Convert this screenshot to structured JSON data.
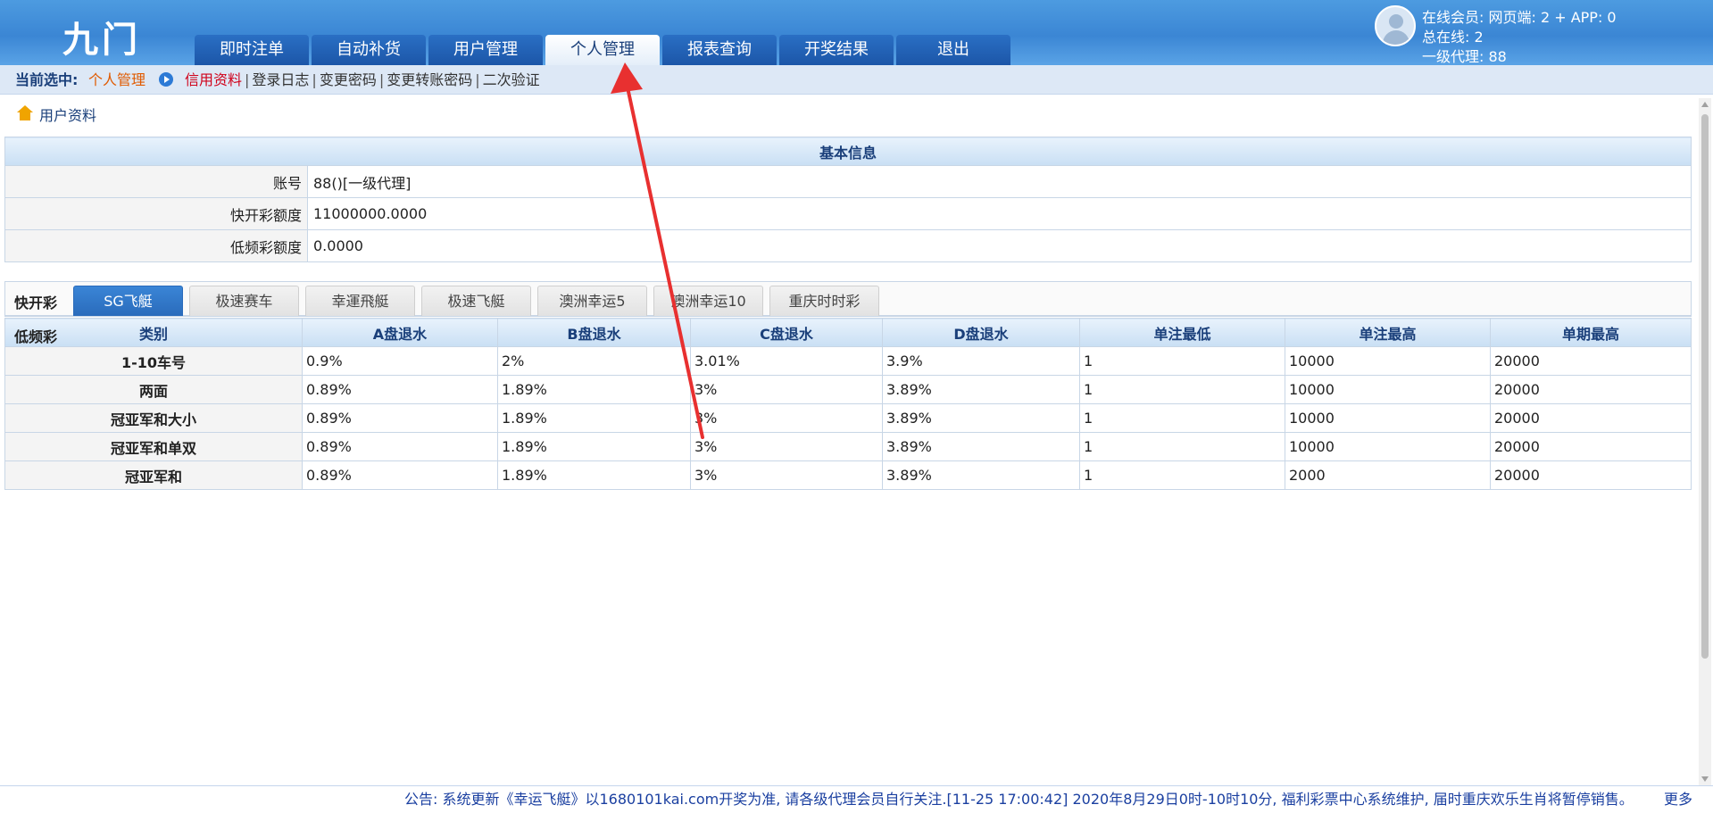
{
  "app": {
    "logo": "九门"
  },
  "nav": [
    "即时注单",
    "自动补货",
    "用户管理",
    "个人管理",
    "报表查询",
    "开奖结果",
    "退出"
  ],
  "nav_active_index": 3,
  "online": {
    "members": "在线会员:  网页端: 2 + APP: 0",
    "total": "总在线: 2",
    "agent": "一级代理: 88"
  },
  "subnav": {
    "label": "当前选中:",
    "current": "个人管理",
    "links": [
      "信用资料",
      "登录日志",
      "变更密码",
      "变更转账密码",
      "二次验证"
    ]
  },
  "breadcrumb": "用户资料",
  "basic_info": {
    "header": "基本信息",
    "rows": [
      {
        "key": "账号",
        "value": "88()[一级代理]"
      },
      {
        "key": "快开彩额度",
        "value": "11000000.0000"
      },
      {
        "key": "低频彩额度",
        "value": "0.0000"
      }
    ]
  },
  "tabs": {
    "label": "快开彩",
    "items": [
      "SG飞艇",
      "极速赛车",
      "幸運飛艇",
      "极速飞艇",
      "澳洲幸运5",
      "澳洲幸运10",
      "重庆时时彩"
    ],
    "active_index": 0
  },
  "rates": {
    "corner_label": "低频彩",
    "headers": [
      "类别",
      "A盘退水",
      "B盘退水",
      "C盘退水",
      "D盘退水",
      "单注最低",
      "单注最高",
      "单期最高"
    ],
    "rows": [
      [
        "1-10车号",
        "0.9%",
        "2%",
        "3.01%",
        "3.9%",
        "1",
        "10000",
        "20000"
      ],
      [
        "两面",
        "0.89%",
        "1.89%",
        "3%",
        "3.89%",
        "1",
        "10000",
        "20000"
      ],
      [
        "冠亚军和大小",
        "0.89%",
        "1.89%",
        "3%",
        "3.89%",
        "1",
        "10000",
        "20000"
      ],
      [
        "冠亚军和单双",
        "0.89%",
        "1.89%",
        "3%",
        "3.89%",
        "1",
        "10000",
        "20000"
      ],
      [
        "冠亚军和",
        "0.89%",
        "1.89%",
        "3%",
        "3.89%",
        "1",
        "2000",
        "20000"
      ]
    ]
  },
  "footer": {
    "notice": "公告: 系统更新《幸运飞艇》以1680101kai.com开奖为准, 请各级代理会员自行关注.[11-25 17:00:42] 2020年8月29日0时-10时10分, 福利彩票中心系统维护, 届时重庆欢乐生肖将暂停销售。",
    "more": "更多"
  },
  "colors": {
    "accent": "#3b86d4",
    "active_tab": "#2a6bbb",
    "annotation_arrow": "#e83030",
    "current_selection": "#e05a00"
  }
}
